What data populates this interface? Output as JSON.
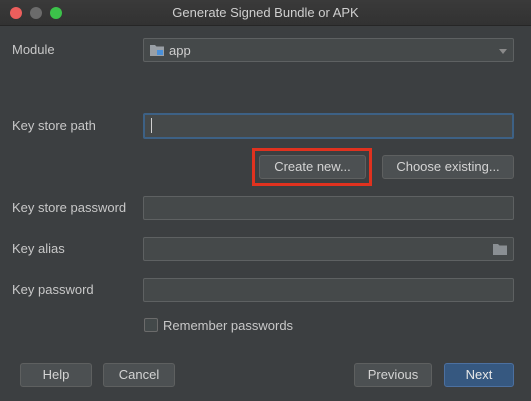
{
  "window": {
    "title": "Generate Signed Bundle or APK"
  },
  "module": {
    "label": "Module",
    "value": "app"
  },
  "keystore": {
    "path_label": "Key store path",
    "path_value": "",
    "create_new_label": "Create new...",
    "choose_existing_label": "Choose existing...",
    "password_label": "Key store password"
  },
  "key": {
    "alias_label": "Key alias",
    "password_label": "Key password"
  },
  "remember": {
    "label": "Remember passwords",
    "checked": false
  },
  "footer": {
    "help_label": "Help",
    "cancel_label": "Cancel",
    "previous_label": "Previous",
    "next_label": "Next"
  },
  "colors": {
    "background": "#3c3f41",
    "field": "#45494a",
    "primary_button": "#365880",
    "highlight": "#e0321f",
    "focus_border": "#3d6185"
  },
  "icons": {
    "module": "folder-icon",
    "alias_browse": "folder-icon",
    "dropdown": "chevron-down-icon"
  }
}
